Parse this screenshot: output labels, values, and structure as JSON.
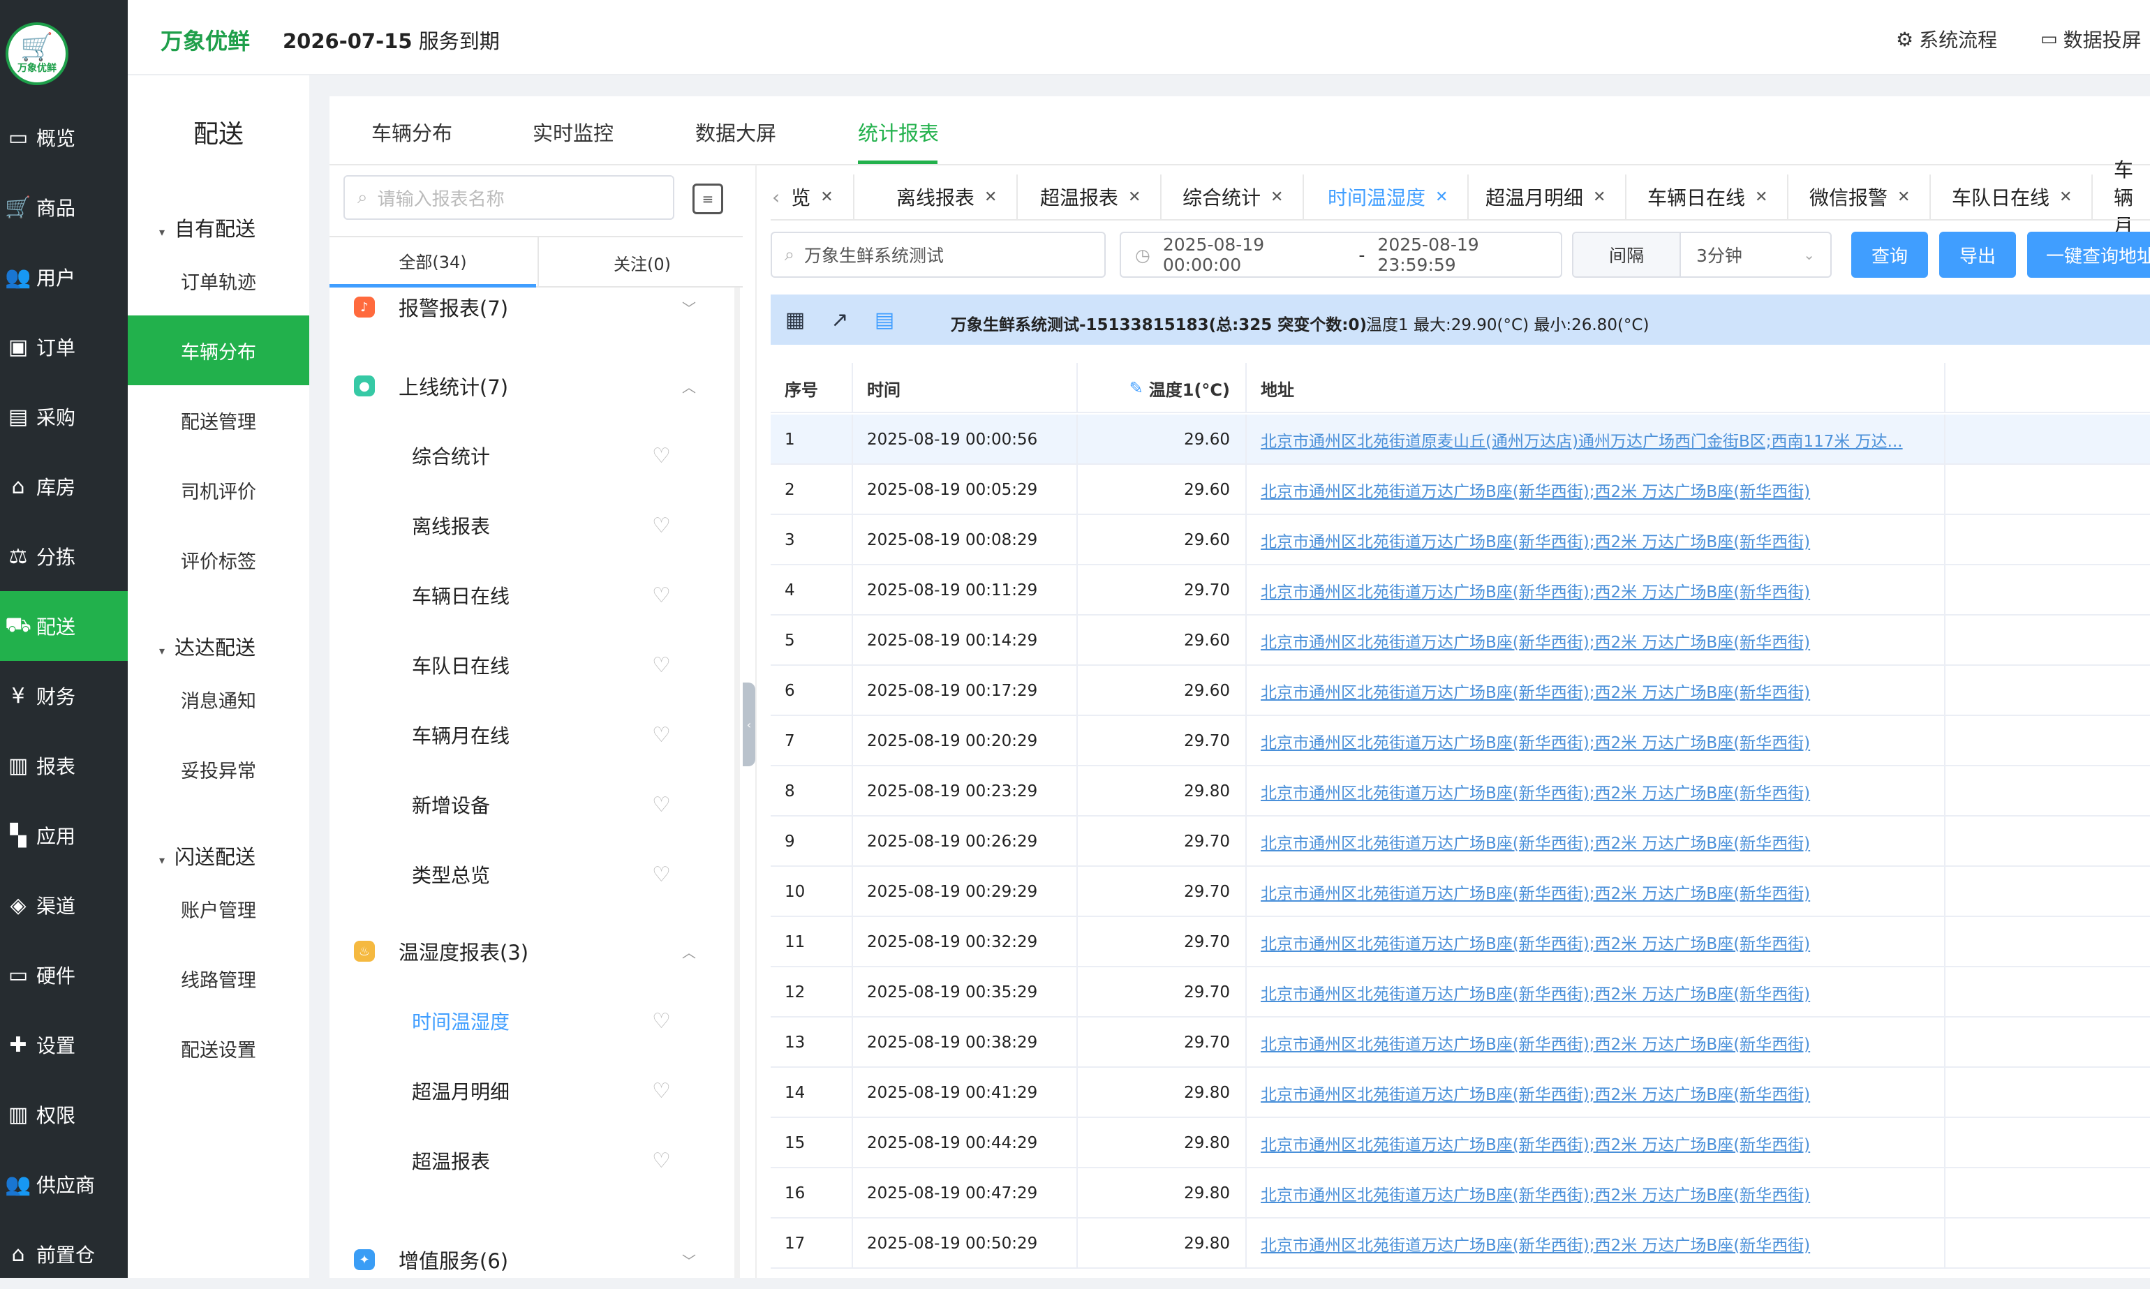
{
  "nav": {
    "logo_text": "万象优鲜",
    "items": [
      {
        "label": "概览",
        "icon": "monitor-icon"
      },
      {
        "label": "商品",
        "icon": "cart-icon"
      },
      {
        "label": "用户",
        "icon": "users-icon"
      },
      {
        "label": "订单",
        "icon": "order-icon"
      },
      {
        "label": "采购",
        "icon": "bus-icon"
      },
      {
        "label": "库房",
        "icon": "warehouse-icon"
      },
      {
        "label": "分拣",
        "icon": "scale-icon"
      },
      {
        "label": "配送",
        "icon": "truck-icon",
        "active": true
      },
      {
        "label": "财务",
        "icon": "yen-icon"
      },
      {
        "label": "报表",
        "icon": "bar-chart-icon"
      },
      {
        "label": "应用",
        "icon": "apps-icon"
      },
      {
        "label": "渠道",
        "icon": "cube-icon"
      },
      {
        "label": "硬件",
        "icon": "hardware-icon"
      },
      {
        "label": "设置",
        "icon": "puzzle-icon"
      },
      {
        "label": "权限",
        "icon": "bank-icon"
      },
      {
        "label": "供应商",
        "icon": "supplier-icon"
      },
      {
        "label": "前置仓",
        "icon": "depot-icon"
      }
    ]
  },
  "header": {
    "brand": "万象优鲜",
    "expiry_date": "2026-07-15",
    "expiry_suffix": "服务到期",
    "links": [
      "系统流程",
      "数据投屏"
    ]
  },
  "subnav": {
    "title": "配送",
    "groups": [
      {
        "label": "自有配送",
        "items": [
          "订单轨迹",
          "车辆分布",
          "配送管理",
          "司机评价",
          "评价标签"
        ]
      },
      {
        "label": "达达配送",
        "items": [
          "消息通知",
          "妥投异常"
        ]
      },
      {
        "label": "闪送配送",
        "items": [
          "账户管理",
          "线路管理",
          "配送设置"
        ]
      }
    ],
    "active_item": "车辆分布"
  },
  "main_tabs": [
    "车辆分布",
    "实时监控",
    "数据大屏",
    "统计报表"
  ],
  "report_panel": {
    "search_placeholder": "请输入报表名称",
    "filter_tabs": [
      "全部(34)",
      "关注(0)"
    ],
    "categories": [
      {
        "label": "报警报表(7)",
        "icon": "bell-icon",
        "color": "#ff6a3d"
      },
      {
        "label": "上线统计(7)",
        "icon": "online-icon",
        "color": "#36c9a5",
        "items": [
          "综合统计",
          "离线报表",
          "车辆日在线",
          "车队日在线",
          "车辆月在线",
          "新增设备",
          "类型总览"
        ]
      },
      {
        "label": "温湿度报表(3)",
        "icon": "thermometer-icon",
        "color": "#f5b940",
        "items": [
          "时间温湿度",
          "超温月明细",
          "超温报表"
        ]
      },
      {
        "label": "增值服务(6)",
        "icon": "service-icon",
        "color": "#3a9df5"
      }
    ],
    "active_report": "时间温湿度"
  },
  "tag_tabs": [
    "览",
    "离线报表",
    "超温报表",
    "综合统计",
    "时间温湿度",
    "超温月明细",
    "车辆日在线",
    "微信报警",
    "车队日在线",
    "车辆月"
  ],
  "active_tag_tab": "时间温湿度",
  "query": {
    "vehicle": "万象生鲜系统测试",
    "date_start": "2025-08-19 00:00:00",
    "date_sep": "-",
    "date_end": "2025-08-19 23:59:59",
    "interval_label": "间隔",
    "interval_value": "3分钟",
    "buttons": [
      "查询",
      "导出",
      "一键查询地址"
    ]
  },
  "info": {
    "title": "万象生鲜系统测试-15133815183(总:325 突变个数:0)",
    "temp_summary": "温度1 最大:29.90(°C) 最小:26.80(°C)"
  },
  "table": {
    "headers": [
      "序号",
      "时间",
      "温度1(°C)",
      "地址"
    ],
    "rows": [
      [
        "1",
        "2025-08-19 00:00:56",
        "29.60",
        "北京市通州区北苑街道原麦山丘(通州万达店)通州万达广场西门金街B区;西南117米 万达..."
      ],
      [
        "2",
        "2025-08-19 00:05:29",
        "29.60",
        "北京市通州区北苑街道万达广场B座(新华西街);西2米 万达广场B座(新华西街)"
      ],
      [
        "3",
        "2025-08-19 00:08:29",
        "29.60",
        "北京市通州区北苑街道万达广场B座(新华西街);西2米 万达广场B座(新华西街)"
      ],
      [
        "4",
        "2025-08-19 00:11:29",
        "29.70",
        "北京市通州区北苑街道万达广场B座(新华西街);西2米 万达广场B座(新华西街)"
      ],
      [
        "5",
        "2025-08-19 00:14:29",
        "29.60",
        "北京市通州区北苑街道万达广场B座(新华西街);西2米 万达广场B座(新华西街)"
      ],
      [
        "6",
        "2025-08-19 00:17:29",
        "29.60",
        "北京市通州区北苑街道万达广场B座(新华西街);西2米 万达广场B座(新华西街)"
      ],
      [
        "7",
        "2025-08-19 00:20:29",
        "29.70",
        "北京市通州区北苑街道万达广场B座(新华西街);西2米 万达广场B座(新华西街)"
      ],
      [
        "8",
        "2025-08-19 00:23:29",
        "29.80",
        "北京市通州区北苑街道万达广场B座(新华西街);西2米 万达广场B座(新华西街)"
      ],
      [
        "9",
        "2025-08-19 00:26:29",
        "29.70",
        "北京市通州区北苑街道万达广场B座(新华西街);西2米 万达广场B座(新华西街)"
      ],
      [
        "10",
        "2025-08-19 00:29:29",
        "29.70",
        "北京市通州区北苑街道万达广场B座(新华西街);西2米 万达广场B座(新华西街)"
      ],
      [
        "11",
        "2025-08-19 00:32:29",
        "29.70",
        "北京市通州区北苑街道万达广场B座(新华西街);西2米 万达广场B座(新华西街)"
      ],
      [
        "12",
        "2025-08-19 00:35:29",
        "29.70",
        "北京市通州区北苑街道万达广场B座(新华西街);西2米 万达广场B座(新华西街)"
      ],
      [
        "13",
        "2025-08-19 00:38:29",
        "29.70",
        "北京市通州区北苑街道万达广场B座(新华西街);西2米 万达广场B座(新华西街)"
      ],
      [
        "14",
        "2025-08-19 00:41:29",
        "29.80",
        "北京市通州区北苑街道万达广场B座(新华西街);西2米 万达广场B座(新华西街)"
      ],
      [
        "15",
        "2025-08-19 00:44:29",
        "29.80",
        "北京市通州区北苑街道万达广场B座(新华西街);西2米 万达广场B座(新华西街)"
      ],
      [
        "16",
        "2025-08-19 00:47:29",
        "29.80",
        "北京市通州区北苑街道万达广场B座(新华西街);西2米 万达广场B座(新华西街)"
      ],
      [
        "17",
        "2025-08-19 00:50:29",
        "29.80",
        "北京市通州区北苑街道万达广场B座(新华西街);西2米 万达广场B座(新华西街)"
      ]
    ]
  },
  "colors": {
    "brand_green": "#22b14c",
    "link_blue": "#409eff",
    "nav_bg": "#262c30"
  }
}
